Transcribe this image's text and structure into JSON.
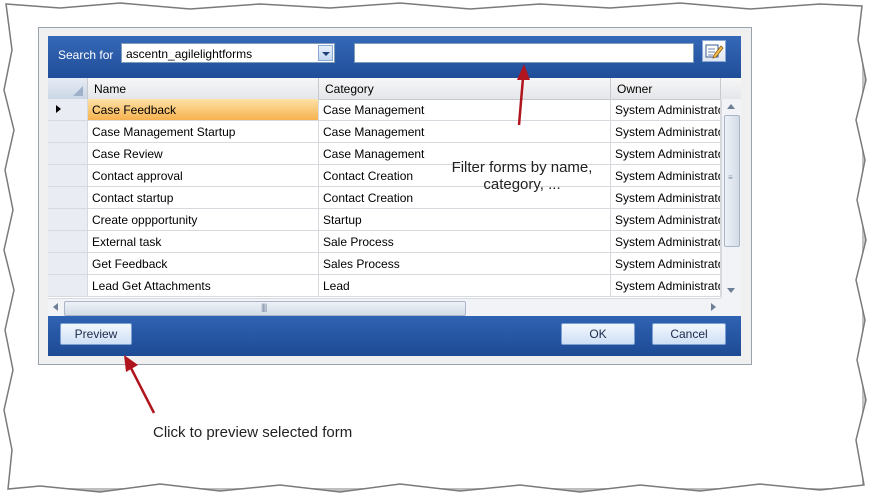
{
  "search": {
    "label": "Search for",
    "selected_form": "ascentn_agilelightforms",
    "filter_value": ""
  },
  "grid": {
    "columns": [
      "Name",
      "Category",
      "Owner"
    ],
    "rows": [
      {
        "name": "Case Feedback",
        "category": "Case Management",
        "owner": "System Administrator",
        "selected": true
      },
      {
        "name": "Case Management Startup",
        "category": "Case Management",
        "owner": "System Administrator"
      },
      {
        "name": "Case Review",
        "category": "Case Management",
        "owner": "System Administrator"
      },
      {
        "name": "Contact approval",
        "category": "Contact Creation",
        "owner": "System Administrator"
      },
      {
        "name": "Contact startup",
        "category": "Contact Creation",
        "owner": "System Administrator"
      },
      {
        "name": "Create oppportunity",
        "category": "Startup",
        "owner": "System Administrator"
      },
      {
        "name": "External task",
        "category": "Sale Process",
        "owner": "System Administrator"
      },
      {
        "name": "Get Feedback",
        "category": "Sales Process",
        "owner": "System Administrator"
      },
      {
        "name": "Lead Get Attachments",
        "category": "Lead",
        "owner": "System Administrator"
      }
    ]
  },
  "buttons": {
    "preview": "Preview",
    "ok": "OK",
    "cancel": "Cancel"
  },
  "annotations": {
    "filter_line1": "Filter forms by name,",
    "filter_line2": "category, ...",
    "preview_note": "Click to preview selected form"
  },
  "colors": {
    "header_blue": "#2a5aa8",
    "selection_orange": "#f7b24f",
    "arrow_red": "#b0141c"
  },
  "icons": {
    "dropdown": "chevron-down-icon",
    "edit": "edit-icon",
    "row_pointer": "row-selector-icon"
  }
}
